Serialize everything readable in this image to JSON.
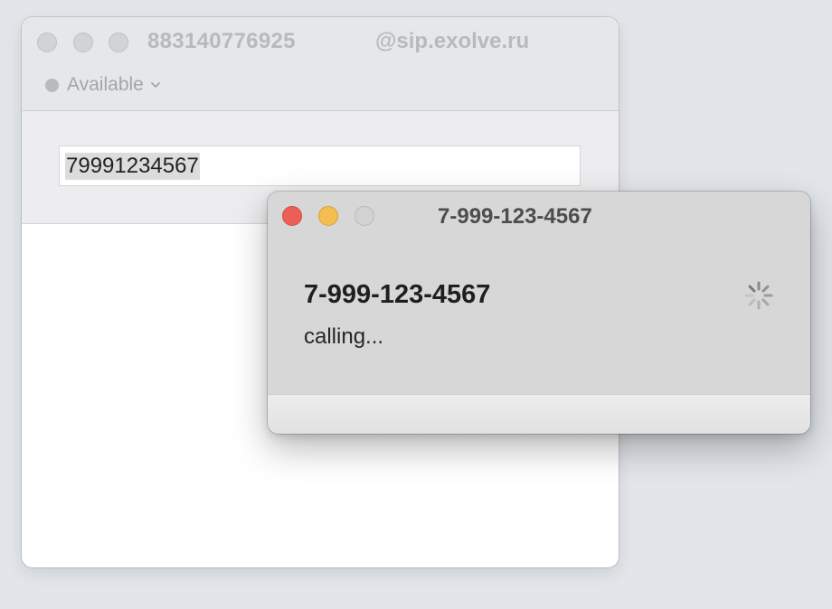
{
  "main_window": {
    "account_user": "883140776925",
    "account_domain": "@sip.exolve.ru",
    "status": {
      "label": "Available",
      "icon": "chevron-down-icon",
      "dot_color": "#b9babd"
    },
    "dial_field": {
      "value": "79991234567"
    }
  },
  "call_window": {
    "title": "7-999-123-4567",
    "number": "7-999-123-4567",
    "status": "calling...",
    "icon": "spinner-icon",
    "colors": {
      "close": "#ec5f57",
      "minimize": "#f3bd4f",
      "zoom": "#d2d2d2"
    }
  }
}
